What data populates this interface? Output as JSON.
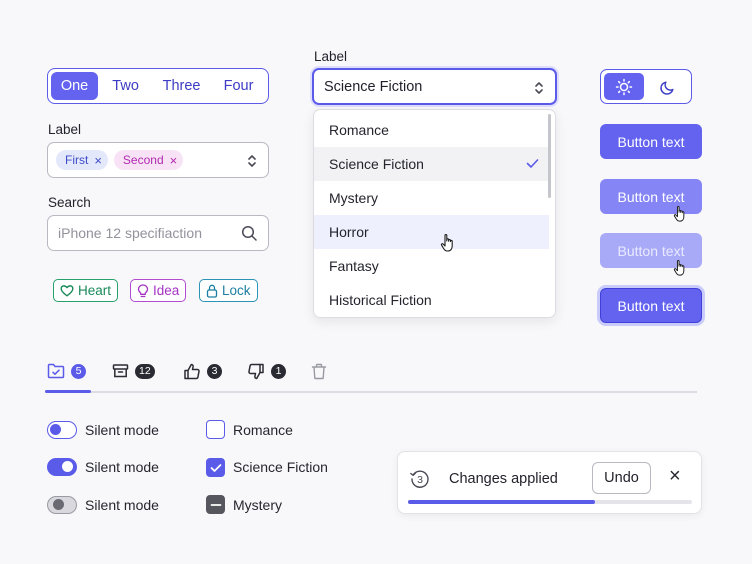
{
  "segmented": {
    "items": [
      "One",
      "Two",
      "Three",
      "Four"
    ],
    "active_index": 0
  },
  "multiselect": {
    "label": "Label",
    "chips": [
      "First",
      "Second"
    ]
  },
  "search": {
    "label": "Search",
    "placeholder": "iPhone 12 specifiaction"
  },
  "tags": {
    "heart": "Heart",
    "idea": "Idea",
    "lock": "Lock"
  },
  "select": {
    "label": "Label",
    "value": "Science Fiction"
  },
  "dropdown": {
    "options": [
      "Romance",
      "Science Fiction",
      "Mystery",
      "Horror",
      "Fantasy",
      "Historical Fiction"
    ],
    "selected": "Science Fiction",
    "hovered": "Horror"
  },
  "theme": {
    "options": [
      "sun-icon",
      "moon-icon"
    ],
    "active": "sun"
  },
  "buttons": {
    "label": "Button text",
    "states": [
      "default",
      "hover",
      "disabled",
      "focused"
    ],
    "colors": {
      "default": "#6363f0",
      "hover": "#8585f5",
      "disabled": "#a8aaf8",
      "focus_ring": "#c9cbfb"
    }
  },
  "tabs": [
    {
      "icon": "folder-check-icon",
      "count": "5",
      "active": true
    },
    {
      "icon": "archive-icon",
      "count": "12",
      "active": false
    },
    {
      "icon": "thumbs-up-icon",
      "count": "3",
      "active": false
    },
    {
      "icon": "thumbs-down-icon",
      "count": "1",
      "active": false
    },
    {
      "icon": "trash-icon",
      "count": "",
      "active": false
    }
  ],
  "toggles": [
    {
      "label": "Silent mode",
      "state": "off"
    },
    {
      "label": "Silent mode",
      "state": "on"
    },
    {
      "label": "Silent mode",
      "state": "disabled"
    }
  ],
  "checkboxes": [
    {
      "label": "Romance",
      "state": "unchecked"
    },
    {
      "label": "Science Fiction",
      "state": "checked"
    },
    {
      "label": "Mystery",
      "state": "indeterminate"
    }
  ],
  "toast": {
    "message": "Changes applied",
    "countdown": "3",
    "undo": "Undo",
    "close": "×",
    "progress": 0.66
  },
  "colors": {
    "accent": "#5b5bea",
    "accent_fill": "#6363f0"
  }
}
